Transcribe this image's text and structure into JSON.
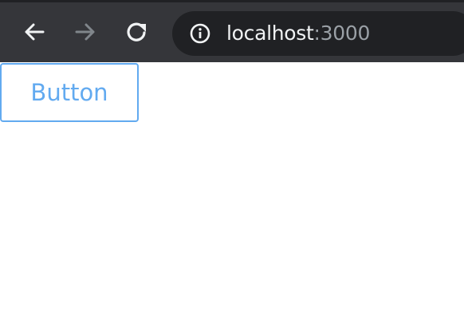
{
  "toolbar": {
    "back_icon": "arrow-left-icon",
    "forward_icon": "arrow-right-icon",
    "reload_icon": "reload-icon",
    "info_icon": "info-icon",
    "colors": {
      "toolbar_bg": "#35363a",
      "address_bg": "#202124",
      "icon_active": "#f1f3f4",
      "icon_disabled": "#80868b",
      "url_dim": "#9aa0a6"
    }
  },
  "address_bar": {
    "host": "localhost",
    "port": ":3000"
  },
  "page": {
    "button_label": "Button",
    "accent": "#62aaf0"
  }
}
